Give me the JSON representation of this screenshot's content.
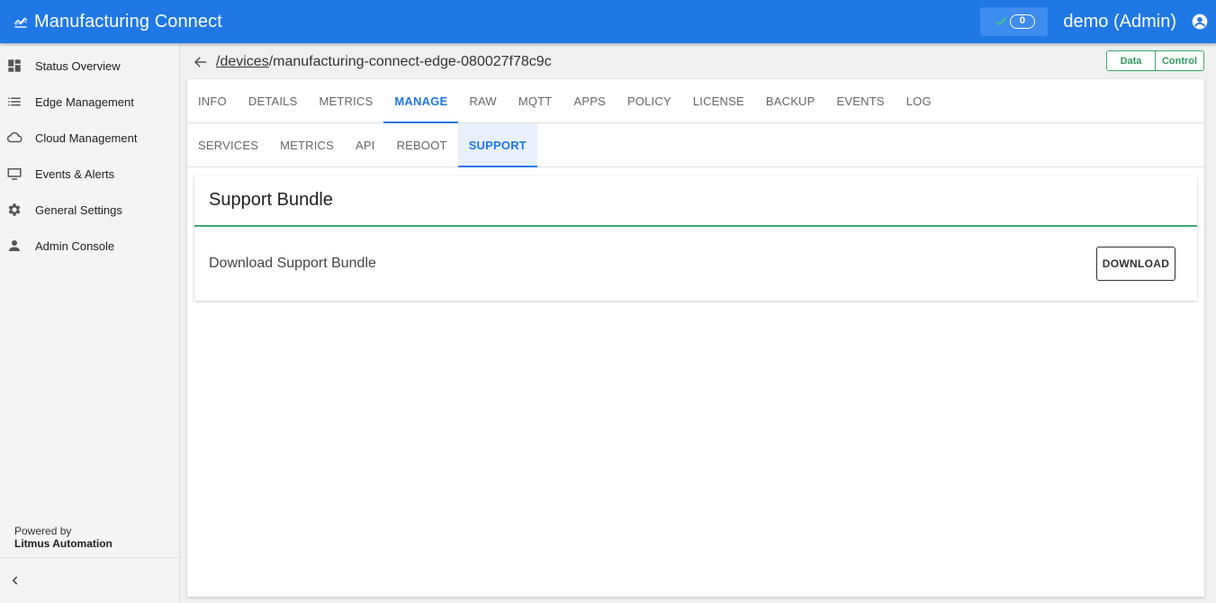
{
  "header": {
    "title": "Manufacturing Connect",
    "status_count": "0",
    "user": "demo (Admin)"
  },
  "sidebar": {
    "items": [
      {
        "label": "Status Overview",
        "icon": "dashboard-icon"
      },
      {
        "label": "Edge Management",
        "icon": "list-icon"
      },
      {
        "label": "Cloud Management",
        "icon": "cloud-icon"
      },
      {
        "label": "Events & Alerts",
        "icon": "monitor-icon"
      },
      {
        "label": "General Settings",
        "icon": "gear-icon"
      },
      {
        "label": "Admin Console",
        "icon": "person-icon"
      }
    ],
    "powered_by": "Powered by",
    "company": "Litmus Automation"
  },
  "path": {
    "link": "/devices",
    "rest": "/manufacturing-connect-edge-080027f78c9c"
  },
  "toggle": {
    "data": "Data",
    "control": "Control"
  },
  "tabs": [
    "INFO",
    "DETAILS",
    "METRICS",
    "MANAGE",
    "RAW",
    "MQTT",
    "APPS",
    "POLICY",
    "LICENSE",
    "BACKUP",
    "EVENTS",
    "LOG"
  ],
  "active_tab": "MANAGE",
  "subtabs": [
    "SERVICES",
    "METRICS",
    "API",
    "REBOOT",
    "SUPPORT"
  ],
  "active_subtab": "SUPPORT",
  "card": {
    "title": "Support Bundle",
    "label": "Download Support Bundle",
    "button": "DOWNLOAD"
  },
  "colors": {
    "primary": "#1f78e6",
    "accent_green": "#3aa86b"
  }
}
